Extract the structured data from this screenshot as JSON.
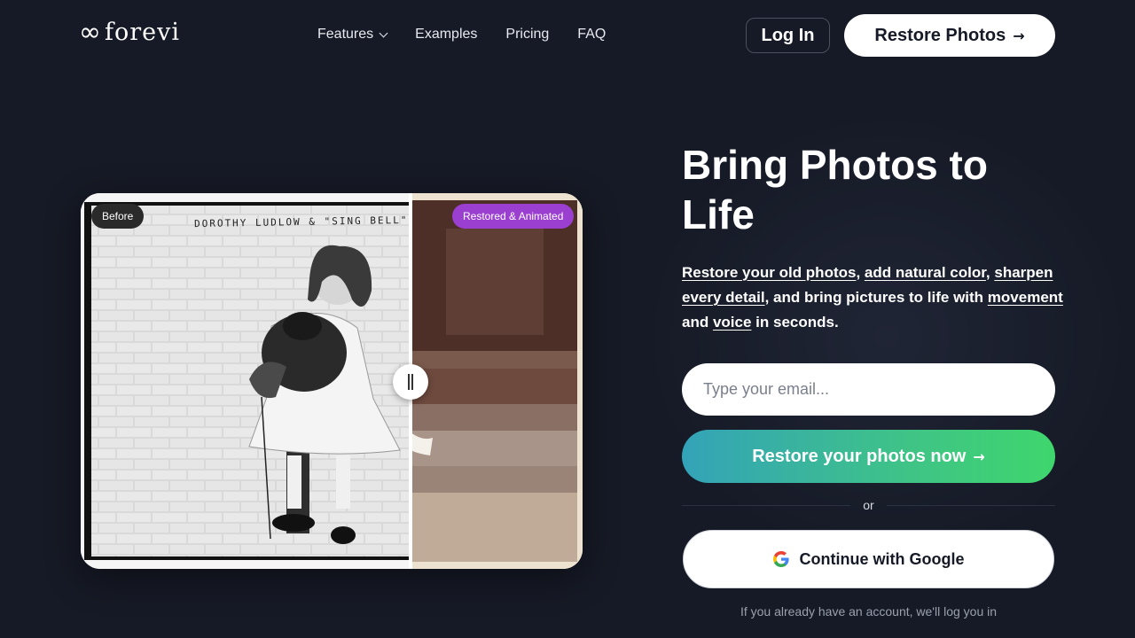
{
  "brand": {
    "logo_icon": "infinity-icon",
    "name": "forevi"
  },
  "nav": {
    "items": [
      {
        "label": "Features",
        "has_dropdown": true
      },
      {
        "label": "Examples"
      },
      {
        "label": "Pricing"
      },
      {
        "label": "FAQ"
      }
    ]
  },
  "header": {
    "login_label": "Log In",
    "restore_label": "Restore Photos",
    "restore_arrow": "→"
  },
  "compare": {
    "before_badge": "Before",
    "after_badge": "Restored & Animated",
    "photo_caption": "DOROTHY LUDLOW & \"SING BELL\"",
    "split_position": 0.66,
    "badge_after_color": "#9a3fd0"
  },
  "hero": {
    "title": "Bring Photos to Life",
    "desc": {
      "link1": "Restore your old photos",
      "sep1": ", ",
      "link2": "add natural color",
      "sep2": ", ",
      "link3": "sharpen every detail",
      "mid": ", and bring pictures to life with ",
      "link4": "movement",
      "and": " and ",
      "link5": "voice",
      "end": " in seconds."
    }
  },
  "form": {
    "email_placeholder": "Type your email...",
    "email_value": "",
    "cta_label": "Restore your photos now",
    "cta_arrow": "→",
    "or_text": "or",
    "google_label": "Continue with Google",
    "account_note": "If you already have an account, we'll log you in"
  },
  "colors": {
    "background": "#161a26",
    "cta_gradient_start": "#33a3b8",
    "cta_gradient_end": "#3fd66d"
  }
}
